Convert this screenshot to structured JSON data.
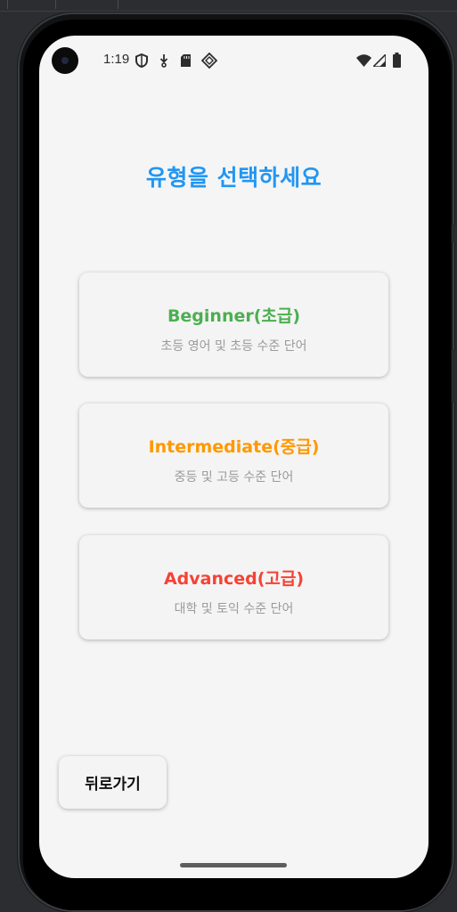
{
  "status_bar": {
    "time": "1:19",
    "left_icons": [
      "shield-icon",
      "download-icon",
      "sd-card-icon",
      "diamond-icon"
    ],
    "right_icons": [
      "wifi-icon",
      "cell-signal-icon",
      "battery-icon"
    ]
  },
  "screen": {
    "title": "유형을 선택하세요",
    "title_color": "#2196f3"
  },
  "levels": [
    {
      "title": "Beginner(초급)",
      "subtitle": "초등 영어 및 초등 수준 단어",
      "color": "#4caf50"
    },
    {
      "title": "Intermediate(중급)",
      "subtitle": "중등 및 고등 수준 단어",
      "color": "#ff9800"
    },
    {
      "title": "Advanced(고급)",
      "subtitle": "대학 및 토익 수준 단어",
      "color": "#f44336"
    }
  ],
  "back_button": {
    "label": "뒤로가기"
  }
}
